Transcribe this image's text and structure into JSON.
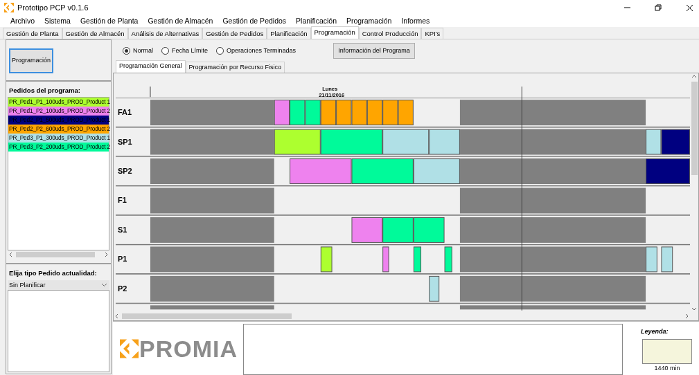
{
  "window": {
    "title": "Prototipo PCP v0.1.6"
  },
  "menu": [
    "Archivo",
    "Sistema",
    "Gestión de Planta",
    "Gestión de Almacén",
    "Gestión de Pedidos",
    "Planificación",
    "Programación",
    "Informes"
  ],
  "tabs": [
    {
      "label": "Gestión de Planta",
      "selected": false
    },
    {
      "label": "Gestión de Almacén",
      "selected": false
    },
    {
      "label": "Análisis de Alternativas",
      "selected": false
    },
    {
      "label": "Gestión de Pedidos",
      "selected": false
    },
    {
      "label": "Planificación",
      "selected": false
    },
    {
      "label": "Programación",
      "selected": true
    },
    {
      "label": "Control Producción",
      "selected": false
    },
    {
      "label": "KPI's",
      "selected": false
    }
  ],
  "left_panel": {
    "button": "Programación",
    "orders_title": "Pedidos del programa:",
    "orders": [
      {
        "label": "PR_Ped1_P1_100uds_PROD_Product 1",
        "color": "#adff2f"
      },
      {
        "label": "PR_Ped1_P2_100uds_PROD_Product 2",
        "color": "#ee82ee"
      },
      {
        "label": "PR_Ped2_P1_500uds_PROD_Product 1",
        "color": "#000080"
      },
      {
        "label": "PR_Ped2_P2_600uds_PROD_Product 2",
        "color": "#ffa500"
      },
      {
        "label": "PR_Ped3_P1_300uds_PROD_Product 1",
        "color": "#b0e0e6"
      },
      {
        "label": "PR_Ped3_P2_200uds_PROD_Product 2",
        "color": "#00fa9a"
      }
    ],
    "type_title": "Elija tipo Pedido actualidad:",
    "type_value": "Sin Planificar"
  },
  "display_modes": [
    {
      "label": "Normal",
      "selected": true
    },
    {
      "label": "Fecha Límite",
      "selected": false
    },
    {
      "label": "Operaciones Terminadas",
      "selected": false
    }
  ],
  "info_button": "Información del Programa",
  "view_tabs": [
    {
      "label": "Programación General",
      "selected": true
    },
    {
      "label": "Programación por Recurso Fisico",
      "selected": false
    }
  ],
  "gantt": {
    "day_name": "Lunes",
    "day_date": "21/11/2016",
    "resources": [
      {
        "name": "FA1"
      },
      {
        "name": "SP1"
      },
      {
        "name": "SP2"
      },
      {
        "name": "F1"
      },
      {
        "name": "S1"
      },
      {
        "name": "P1"
      },
      {
        "name": "P2"
      }
    ]
  },
  "logo_text": "PROMIA",
  "legend": {
    "title": "Leyenda:",
    "caption": "1440 min"
  }
}
